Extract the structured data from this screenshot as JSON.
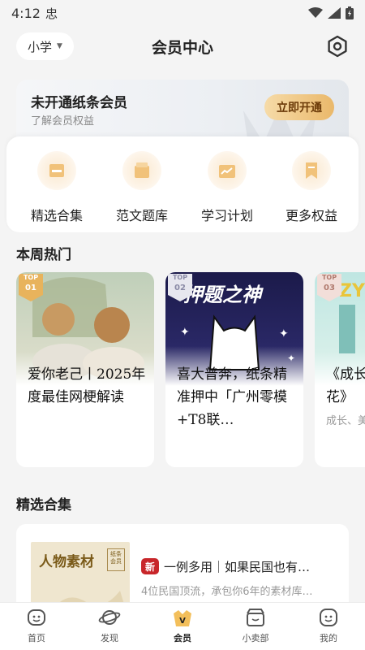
{
  "status_bar": {
    "time": "4:12",
    "notification": "忠"
  },
  "header": {
    "grade": "小学",
    "title": "会员中心"
  },
  "banner": {
    "title": "未开通纸条会员",
    "subtitle": "了解会员权益",
    "button": "立即开通"
  },
  "features": [
    {
      "label": "精选合集",
      "icon": "collection-icon"
    },
    {
      "label": "范文题库",
      "icon": "essay-bank-icon"
    },
    {
      "label": "学习计划",
      "icon": "study-plan-icon"
    },
    {
      "label": "更多权益",
      "icon": "more-benefits-icon"
    }
  ],
  "weekly_hot": {
    "title": "本周热门",
    "cards": [
      {
        "rank_label": "TOP",
        "rank": "01",
        "title": "爱你老己丨2025年度最佳网梗解读",
        "subtitle": ""
      },
      {
        "rank_label": "TOP",
        "rank": "02",
        "title": "喜大普奔，纸条精准押中「广州零模+T8联…",
        "subtitle": "",
        "image_text": "押题之神"
      },
      {
        "rank_label": "TOP",
        "rank": "03",
        "title": "《成长花》",
        "subtitle": "成长、美"
      }
    ]
  },
  "selected": {
    "title": "精选合集",
    "items": [
      {
        "badge": "新",
        "title": "一例多用｜如果民国也有…",
        "desc": "4位民国顶流，承包你6年的素材库…",
        "cover_title": "人物素材",
        "cover_stamp": "纸条会员"
      }
    ]
  },
  "tabbar": [
    {
      "label": "首页",
      "icon": "home-icon",
      "active": false
    },
    {
      "label": "发现",
      "icon": "planet-icon",
      "active": false
    },
    {
      "label": "会员",
      "icon": "vip-icon",
      "active": true
    },
    {
      "label": "小卖部",
      "icon": "shop-icon",
      "active": false
    },
    {
      "label": "我的",
      "icon": "profile-icon",
      "active": false
    }
  ]
}
